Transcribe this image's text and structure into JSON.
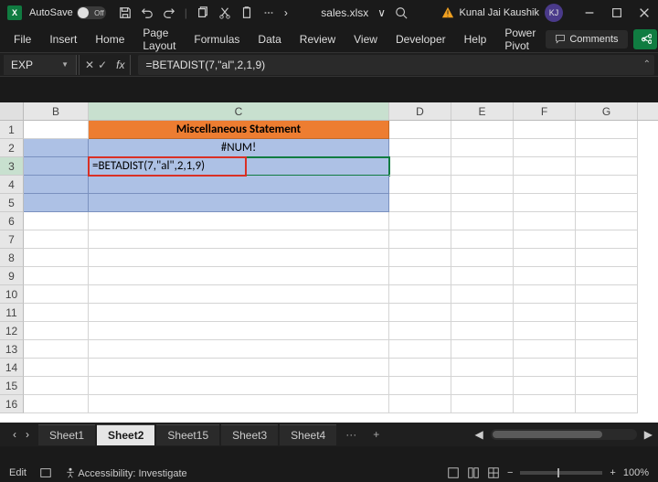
{
  "title_bar": {
    "app_badge": "X",
    "autosave_label": "AutoSave",
    "autosave_state": "Off",
    "filename": "sales.xlsx",
    "chevron": "›",
    "user_name": "Kunal Jai Kaushik",
    "user_initials": "KJ"
  },
  "ribbon": {
    "tabs": [
      "File",
      "Insert",
      "Home",
      "Page Layout",
      "Formulas",
      "Data",
      "Review",
      "View",
      "Developer",
      "Help",
      "Power Pivot"
    ],
    "comments_label": "Comments"
  },
  "formula_bar": {
    "name_box": "EXP",
    "fx_label": "fx",
    "formula": "=BETADIST(7,\"al\",2,1,9)"
  },
  "grid": {
    "columns": [
      "B",
      "C",
      "D",
      "E",
      "F",
      "G"
    ],
    "active_col": "C",
    "active_row": 3,
    "rows": [
      1,
      2,
      3,
      4,
      5,
      6,
      7,
      8,
      9,
      10,
      11,
      12,
      13,
      14,
      15,
      16
    ],
    "r1_c": "Miscellaneous Statement",
    "r2_c": "#NUM!",
    "r3_c": "=BETADIST(7,\"al\",2,1,9)"
  },
  "tabs": {
    "list": [
      "Sheet1",
      "Sheet2",
      "Sheet15",
      "Sheet3",
      "Sheet4"
    ],
    "active": 1,
    "more": "···",
    "add": "+"
  },
  "status": {
    "mode": "Edit",
    "accessibility": "Accessibility: Investigate",
    "zoom_minus": "−",
    "zoom_plus": "+",
    "zoom_value": "100%"
  }
}
